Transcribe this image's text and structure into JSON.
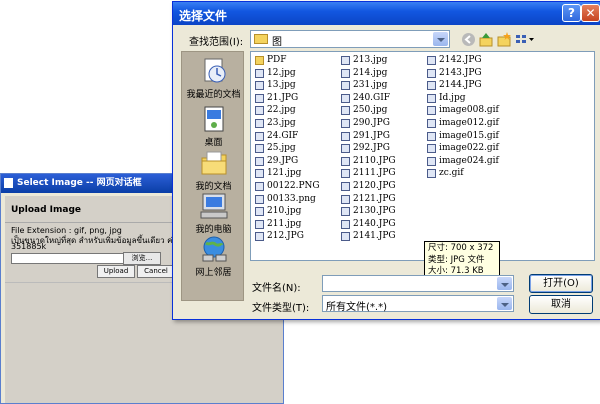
{
  "background_dialog": {
    "title": "Select Image -- 网页对话框",
    "heading": "Upload Image",
    "ext_text": "File Extension : gif, png, jpg",
    "thai_text": "เป็นขนาดใหญ่ที่สุด สำหรับเพิ่มข้อมูลขึ้นเดียว ค่ะ",
    "size_text": "351885k",
    "browse_label": "浏览...",
    "upload_label": "Upload",
    "cancel_label": "Cancel"
  },
  "dialog": {
    "title": "选择文件",
    "lookin_label": "查找范围(I):",
    "lookin_value": "图",
    "filename_label": "文件名(N):",
    "filename_value": "",
    "filetype_label": "文件类型(T):",
    "filetype_value": "所有文件(*.*)",
    "open_label": "打开(O)",
    "cancel_label": "取消"
  },
  "places": [
    {
      "label": "我最近的文档",
      "icon": "recent-docs-icon"
    },
    {
      "label": "桌面",
      "icon": "desktop-icon"
    },
    {
      "label": "我的文档",
      "icon": "my-documents-icon"
    },
    {
      "label": "我的电脑",
      "icon": "my-computer-icon"
    },
    {
      "label": "网上邻居",
      "icon": "network-places-icon"
    }
  ],
  "files": {
    "col1": [
      "PDF",
      "12.jpg",
      "13.jpg",
      "21.JPG",
      "22.jpg",
      "23.jpg",
      "24.GIF",
      "25.jpg",
      "29.JPG",
      "121.jpg",
      "00122.PNG",
      "00133.png",
      "210.jpg",
      "211.jpg",
      "212.JPG"
    ],
    "col2": [
      "213.jpg",
      "214.jpg",
      "231.jpg",
      "240.GIF",
      "250.jpg",
      "290.JPG",
      "291.JPG",
      "292.JPG",
      "2110.JPG",
      "2111.JPG",
      "2120.JPG",
      "2121.JPG",
      "2130.JPG",
      "2140.JPG",
      "2141.JPG"
    ],
    "col3": [
      "2142.JPG",
      "2143.JPG",
      "2144.JPG",
      "Id.jpg",
      "image008.gif",
      "image012.gif",
      "image015.gif",
      "image022.gif",
      "image024.gif",
      "zc.gif"
    ]
  },
  "tooltip": {
    "line1": "尺寸: 700 x 372",
    "line2": "类型: JPG 文件",
    "line3": "大小: 71.3 KB"
  }
}
